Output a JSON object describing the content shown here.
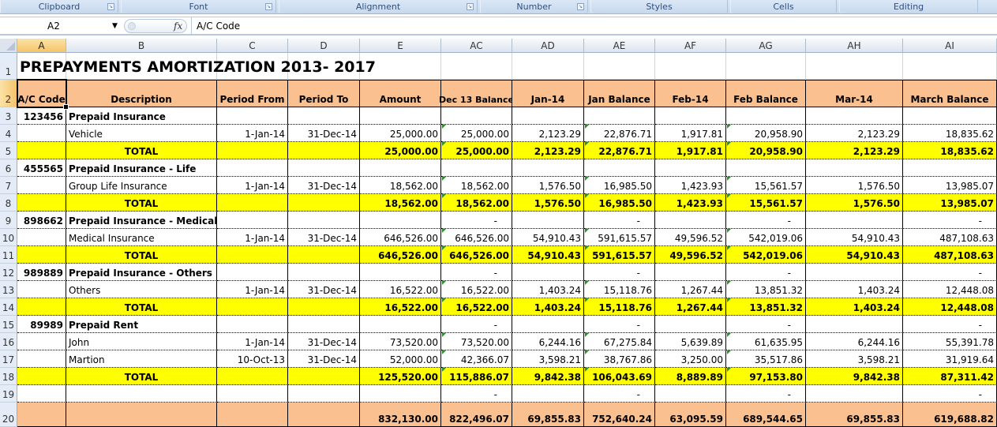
{
  "ribbon": {
    "groups": [
      {
        "label": "Clipboard",
        "launcher": true
      },
      {
        "label": "Font",
        "launcher": true
      },
      {
        "label": "Alignment",
        "launcher": true
      },
      {
        "label": "Number",
        "launcher": true
      },
      {
        "label": "Styles",
        "launcher": false
      },
      {
        "label": "Cells",
        "launcher": false
      },
      {
        "label": "Editing",
        "launcher": false
      }
    ]
  },
  "formula_bar": {
    "name_box": "A2",
    "fx_label": "fx",
    "content": "A/C Code"
  },
  "columns": [
    "A",
    "B",
    "C",
    "D",
    "E",
    "AC",
    "AD",
    "AE",
    "AF",
    "AG",
    "AH",
    "AI"
  ],
  "selected_column": "A",
  "selected_row": "2",
  "sheet": {
    "title": "PREPAYMENTS AMORTIZATION  2013- 2017",
    "headers": [
      "A/C Code",
      "Description",
      "Period From",
      "Period To",
      "Amount",
      "Dec 13 Balance",
      "Jan-14",
      "Jan Balance",
      "Feb-14",
      "Feb Balance",
      "Mar-14",
      "March Balance"
    ],
    "rows": [
      {
        "row": "3",
        "type": "group",
        "cells": [
          "123456",
          "Prepaid Insurance",
          "",
          "",
          "",
          "",
          "",
          "",
          "",
          "",
          "",
          ""
        ]
      },
      {
        "row": "4",
        "type": "item",
        "cells": [
          "",
          "Vehicle",
          "1-Jan-14",
          "31-Dec-14",
          "25,000.00",
          "25,000.00",
          "2,123.29",
          "22,876.71",
          "1,917.81",
          "20,958.90",
          "2,123.29",
          "18,835.62"
        ]
      },
      {
        "row": "5",
        "type": "total",
        "cells": [
          "",
          "TOTAL",
          "",
          "",
          "25,000.00",
          "25,000.00",
          "2,123.29",
          "22,876.71",
          "1,917.81",
          "20,958.90",
          "2,123.29",
          "18,835.62"
        ]
      },
      {
        "row": "6",
        "type": "group",
        "cells": [
          "455565",
          "Prepaid Insurance - Life",
          "",
          "",
          "",
          "",
          "",
          "",
          "",
          "",
          "",
          ""
        ]
      },
      {
        "row": "7",
        "type": "item",
        "cells": [
          "",
          "Group Life Insurance",
          "1-Jan-14",
          "31-Dec-14",
          "18,562.00",
          "18,562.00",
          "1,576.50",
          "16,985.50",
          "1,423.93",
          "15,561.57",
          "1,576.50",
          "13,985.07"
        ]
      },
      {
        "row": "8",
        "type": "total",
        "cells": [
          "",
          "TOTAL",
          "",
          "",
          "18,562.00",
          "18,562.00",
          "1,576.50",
          "16,985.50",
          "1,423.93",
          "15,561.57",
          "1,576.50",
          "13,985.07"
        ]
      },
      {
        "row": "9",
        "type": "group",
        "cells": [
          "898662",
          "Prepaid Insurance - Medical",
          "",
          "",
          "",
          "-",
          "",
          "-",
          "",
          "-",
          "",
          "-"
        ]
      },
      {
        "row": "10",
        "type": "item",
        "cells": [
          "",
          "Medical Insurance",
          "1-Jan-14",
          "31-Dec-14",
          "646,526.00",
          "646,526.00",
          "54,910.43",
          "591,615.57",
          "49,596.52",
          "542,019.06",
          "54,910.43",
          "487,108.63"
        ]
      },
      {
        "row": "11",
        "type": "total",
        "cells": [
          "",
          "TOTAL",
          "",
          "",
          "646,526.00",
          "646,526.00",
          "54,910.43",
          "591,615.57",
          "49,596.52",
          "542,019.06",
          "54,910.43",
          "487,108.63"
        ]
      },
      {
        "row": "12",
        "type": "group",
        "cells": [
          "989889",
          "Prepaid Insurance - Others",
          "",
          "",
          "",
          "-",
          "",
          "-",
          "",
          "-",
          "",
          "-"
        ]
      },
      {
        "row": "13",
        "type": "item",
        "cells": [
          "",
          "Others",
          "1-Jan-14",
          "31-Dec-14",
          "16,522.00",
          "16,522.00",
          "1,403.24",
          "15,118.76",
          "1,267.44",
          "13,851.32",
          "1,403.24",
          "12,448.08"
        ]
      },
      {
        "row": "14",
        "type": "total",
        "cells": [
          "",
          "TOTAL",
          "",
          "",
          "16,522.00",
          "16,522.00",
          "1,403.24",
          "15,118.76",
          "1,267.44",
          "13,851.32",
          "1,403.24",
          "12,448.08"
        ]
      },
      {
        "row": "15",
        "type": "group",
        "cells": [
          "89989",
          "Prepaid Rent",
          "",
          "",
          "",
          "-",
          "",
          "-",
          "",
          "-",
          "",
          "-"
        ]
      },
      {
        "row": "16",
        "type": "item",
        "cells": [
          "",
          "John",
          "1-Jan-14",
          "31-Dec-14",
          "73,520.00",
          "73,520.00",
          "6,244.16",
          "67,275.84",
          "5,639.89",
          "61,635.95",
          "6,244.16",
          "55,391.78"
        ]
      },
      {
        "row": "17",
        "type": "item",
        "cells": [
          "",
          "Martion",
          "10-Oct-13",
          "31-Dec-14",
          "52,000.00",
          "42,366.07",
          "3,598.21",
          "38,767.86",
          "3,250.00",
          "35,517.86",
          "3,598.21",
          "31,919.64"
        ]
      },
      {
        "row": "18",
        "type": "total",
        "cells": [
          "",
          "TOTAL",
          "",
          "",
          "125,520.00",
          "115,886.07",
          "9,842.38",
          "106,043.69",
          "8,889.89",
          "97,153.80",
          "9,842.38",
          "87,311.42"
        ]
      },
      {
        "row": "19",
        "type": "blank",
        "cells": [
          "",
          "",
          "",
          "",
          "",
          "-",
          "",
          "-",
          "",
          "-",
          "",
          "-"
        ]
      },
      {
        "row": "20",
        "type": "grand",
        "cells": [
          "",
          "",
          "",
          "",
          "832,130.00",
          "822,496.07",
          "69,855.83",
          "752,640.24",
          "63,095.59",
          "689,544.65",
          "69,855.83",
          "619,688.82"
        ]
      }
    ]
  },
  "colors": {
    "header_fill": "#fac090",
    "total_fill": "#ffff00",
    "grand_total_fill": "#fac090",
    "error_indicator": "#2e8b2e"
  }
}
